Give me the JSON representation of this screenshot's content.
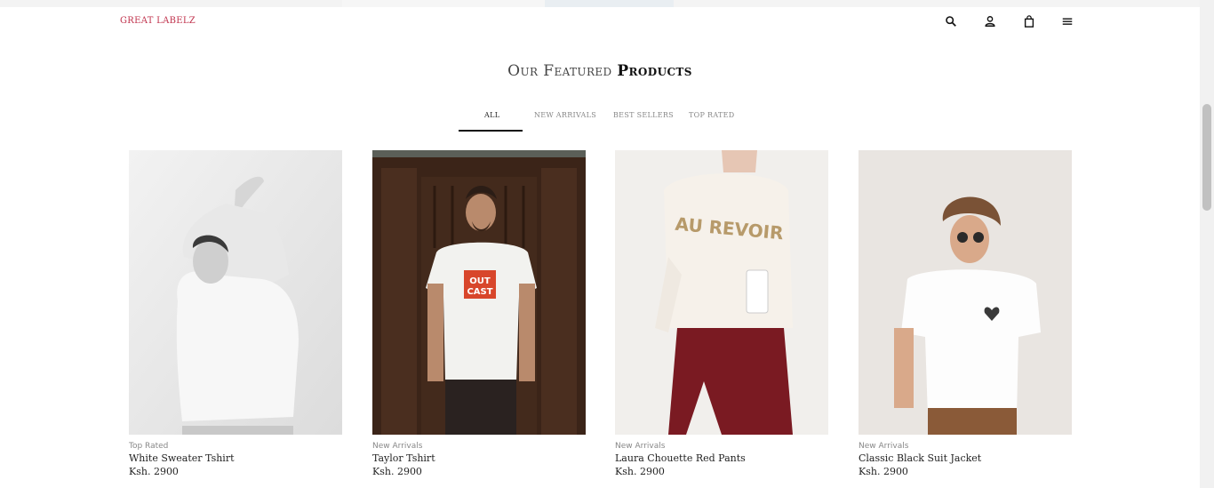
{
  "header": {
    "brand": "GREAT LABELZ",
    "icons": [
      "search-icon",
      "account-icon",
      "cart-icon",
      "menu-icon"
    ]
  },
  "section": {
    "title_part1": "Our Featured",
    "title_part2": "Products"
  },
  "tabs": [
    {
      "label": "ALL",
      "active": true
    },
    {
      "label": "NEW ARRIVALS",
      "active": false
    },
    {
      "label": "BEST SELLERS",
      "active": false
    },
    {
      "label": "TOP RATED",
      "active": false
    }
  ],
  "products": [
    {
      "category": "Top Rated",
      "name": "White Sweater Tshirt",
      "price": "Ksh. 2900"
    },
    {
      "category": "New Arrivals",
      "name": "Taylor Tshirt",
      "price": "Ksh. 2900"
    },
    {
      "category": "New Arrivals",
      "name": "Laura Chouette Red Pants",
      "price": "Ksh. 2900"
    },
    {
      "category": "New Arrivals",
      "name": "Classic Black Suit Jacket",
      "price": "Ksh. 2900"
    }
  ],
  "shirt_print": {
    "line1": "OUT",
    "line2": "CAST"
  },
  "sweater_print": "AU REVOIR",
  "colors": {
    "brand": "#c0334d",
    "active_tab_underline": "#111111"
  }
}
